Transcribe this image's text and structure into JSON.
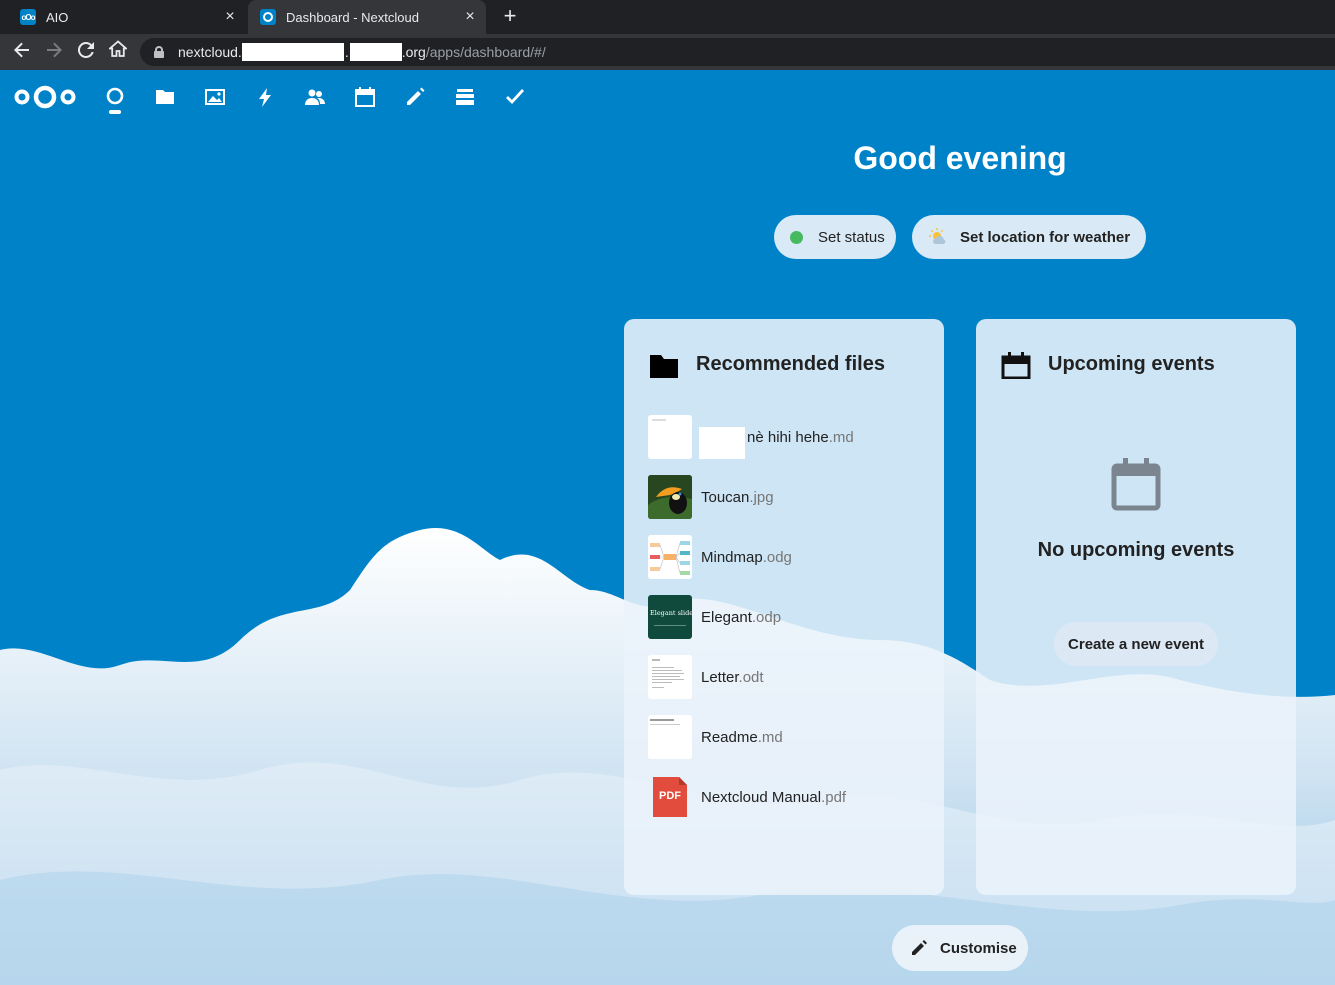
{
  "browser": {
    "tabs": [
      {
        "title": "AIO",
        "active": false
      },
      {
        "title": "Dashboard - Nextcloud",
        "active": true
      }
    ],
    "new_tab_symbol": "+",
    "close_symbol": "×",
    "url": {
      "host_prefix": "nextcloud.",
      "host_suffix": ".org",
      "path": "/apps/dashboard/#/"
    }
  },
  "header": {
    "logo": "nextcloud-logo",
    "apps": [
      {
        "name": "dashboard",
        "icon": "dashboard-icon",
        "active": true
      },
      {
        "name": "files",
        "icon": "folder-icon"
      },
      {
        "name": "photos",
        "icon": "image-icon"
      },
      {
        "name": "activity",
        "icon": "lightning-icon"
      },
      {
        "name": "contacts",
        "icon": "contacts-icon"
      },
      {
        "name": "calendar",
        "icon": "calendar-icon"
      },
      {
        "name": "notes",
        "icon": "pencil-icon"
      },
      {
        "name": "deck",
        "icon": "deck-icon"
      },
      {
        "name": "tasks",
        "icon": "checkmark-icon"
      }
    ]
  },
  "dashboard": {
    "greeting": "Good evening",
    "set_status_label": "Set status",
    "set_weather_label": "Set location for weather",
    "customise_label": "Customise"
  },
  "recommended_files": {
    "title": "Recommended files",
    "files": [
      {
        "name": "nè hihi hehe",
        "ext": ".md",
        "thumb": "blank-doc"
      },
      {
        "name": "Toucan",
        "ext": ".jpg",
        "thumb": "toucan-photo"
      },
      {
        "name": "Mindmap",
        "ext": ".odg",
        "thumb": "mindmap"
      },
      {
        "name": "Elegant",
        "ext": ".odp",
        "thumb": "slides",
        "thumb_text": "Elegant slides"
      },
      {
        "name": "Letter",
        "ext": ".odt",
        "thumb": "letter"
      },
      {
        "name": "Readme",
        "ext": ".md",
        "thumb": "readme"
      },
      {
        "name": "Nextcloud Manual",
        "ext": ".pdf",
        "thumb": "pdf",
        "thumb_text": "PDF"
      }
    ]
  },
  "upcoming_events": {
    "title": "Upcoming events",
    "empty_text": "No upcoming events",
    "create_label": "Create a new event"
  },
  "colors": {
    "primary": "#0082c9",
    "status_online": "#46ba61",
    "pdf_red": "#e14c3c"
  }
}
